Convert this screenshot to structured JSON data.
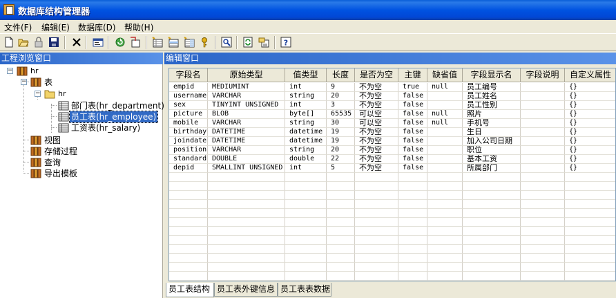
{
  "window": {
    "title": "数据库结构管理器"
  },
  "menu": [
    {
      "label": "文件(F)"
    },
    {
      "label": "编辑(E)"
    },
    {
      "label": "数据库(D)"
    },
    {
      "label": "帮助(H)"
    }
  ],
  "toolbar": {
    "buttons": [
      {
        "icon": "new-file-icon"
      },
      {
        "icon": "open-folder-icon"
      },
      {
        "icon": "lock-icon"
      },
      {
        "icon": "save-icon"
      },
      {
        "icon": "delete-icon"
      },
      {
        "icon": "properties-icon"
      },
      {
        "icon": "refresh-icon"
      },
      {
        "icon": "export-icon"
      },
      {
        "icon": "add-table-icon"
      },
      {
        "icon": "add-field-icon"
      },
      {
        "icon": "add-index-icon"
      },
      {
        "icon": "key-icon"
      },
      {
        "icon": "preview-icon"
      },
      {
        "icon": "sync-icon"
      },
      {
        "icon": "generate-icon"
      },
      {
        "icon": "help-icon"
      }
    ]
  },
  "left_panel": {
    "title": "工程浏览窗口",
    "tree": {
      "root": "hr",
      "tables_label": "表",
      "schema": "hr",
      "tables": [
        {
          "label": "部门表(hr_department)",
          "selected": false
        },
        {
          "label": "员工表(hr_employee)",
          "selected": true
        },
        {
          "label": "工资表(hr_salary)",
          "selected": false
        }
      ],
      "views": "视图",
      "procedures": "存储过程",
      "queries": "查询",
      "export_templates": "导出模板"
    }
  },
  "editor": {
    "title": "编辑窗口",
    "columns": [
      "字段名",
      "原始类型",
      "值类型",
      "长度",
      "是否为空",
      "主键",
      "缺省值",
      "字段显示名",
      "字段说明",
      "自定义属性"
    ],
    "rows": [
      [
        "empid",
        "MEDIUMINT",
        "int",
        "9",
        "不为空",
        "true",
        "null",
        "员工编号",
        "",
        "{}"
      ],
      [
        "username",
        "VARCHAR",
        "string",
        "20",
        "不为空",
        "false",
        "",
        "员工姓名",
        "",
        "{}"
      ],
      [
        "sex",
        "TINYINT UNSIGNED",
        "int",
        "3",
        "不为空",
        "false",
        "",
        "员工性别",
        "",
        "{}"
      ],
      [
        "picture",
        "BLOB",
        "byte[]",
        "65535",
        "可以空",
        "false",
        "null",
        "照片",
        "",
        "{}"
      ],
      [
        "mobile",
        "VARCHAR",
        "string",
        "30",
        "可以空",
        "false",
        "null",
        "手机号",
        "",
        "{}"
      ],
      [
        "birthday",
        "DATETIME",
        "datetime",
        "19",
        "不为空",
        "false",
        "",
        "生日",
        "",
        "{}"
      ],
      [
        "joindate",
        "DATETIME",
        "datetime",
        "19",
        "不为空",
        "false",
        "",
        "加入公司日期",
        "",
        "{}"
      ],
      [
        "position",
        "VARCHAR",
        "string",
        "20",
        "不为空",
        "false",
        "",
        "职位",
        "",
        "{}"
      ],
      [
        "standard",
        "DOUBLE",
        "double",
        "22",
        "不为空",
        "false",
        "",
        "基本工资",
        "",
        "{}"
      ],
      [
        "depid",
        "SMALLINT UNSIGNED",
        "int",
        "5",
        "不为空",
        "false",
        "",
        "所属部门",
        "",
        "{}"
      ]
    ],
    "tabs": [
      {
        "label": "员工表结构",
        "active": true
      },
      {
        "label": "员工表外键信息",
        "active": false
      },
      {
        "label": "员工表表数据",
        "active": false
      }
    ]
  }
}
